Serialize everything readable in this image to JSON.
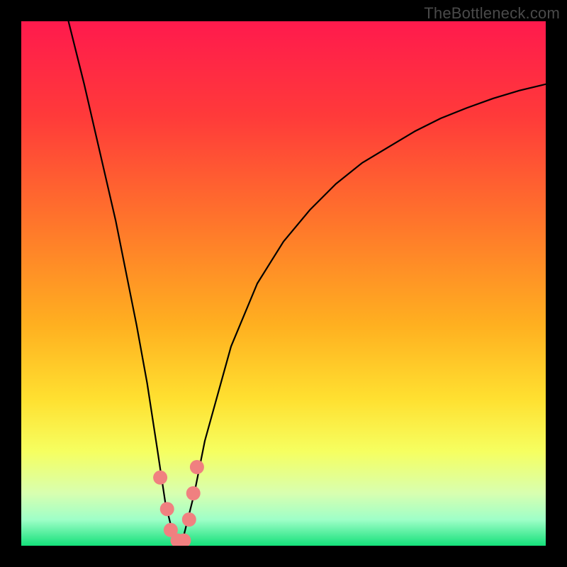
{
  "watermark": "TheBottleneck.com",
  "chart_data": {
    "type": "line",
    "title": "",
    "xlabel": "",
    "ylabel": "",
    "xlim": [
      0,
      100
    ],
    "ylim": [
      0,
      100
    ],
    "grid": false,
    "legend": false,
    "gradient_stops": [
      {
        "offset": 0.0,
        "color": "#ff1a4d"
      },
      {
        "offset": 0.18,
        "color": "#ff3a3a"
      },
      {
        "offset": 0.4,
        "color": "#ff7a2a"
      },
      {
        "offset": 0.58,
        "color": "#ffb020"
      },
      {
        "offset": 0.72,
        "color": "#ffe030"
      },
      {
        "offset": 0.82,
        "color": "#f6ff60"
      },
      {
        "offset": 0.9,
        "color": "#d8ffb0"
      },
      {
        "offset": 0.95,
        "color": "#9fffc8"
      },
      {
        "offset": 1.0,
        "color": "#14e07a"
      }
    ],
    "series": [
      {
        "name": "bottleneck-curve",
        "color": "#000000",
        "x": [
          9,
          12,
          15,
          18,
          20,
          22,
          24,
          26,
          27.5,
          29,
          30,
          31,
          33,
          35,
          40,
          45,
          50,
          55,
          60,
          65,
          70,
          75,
          80,
          85,
          90,
          95,
          100
        ],
        "y": [
          100,
          88,
          75,
          62,
          52,
          42,
          31,
          18,
          8,
          2,
          0,
          2,
          10,
          20,
          38,
          50,
          58,
          64,
          69,
          73,
          76,
          79,
          81.5,
          83.5,
          85.3,
          86.8,
          88
        ]
      }
    ],
    "markers": {
      "name": "highlight-dots",
      "color": "#f08080",
      "radius_px": 10,
      "points": [
        {
          "x": 26.5,
          "y": 13
        },
        {
          "x": 27.8,
          "y": 7
        },
        {
          "x": 28.5,
          "y": 3
        },
        {
          "x": 29.8,
          "y": 1
        },
        {
          "x": 31.0,
          "y": 1
        },
        {
          "x": 32.0,
          "y": 5
        },
        {
          "x": 32.8,
          "y": 10
        },
        {
          "x": 33.5,
          "y": 15
        }
      ]
    }
  }
}
